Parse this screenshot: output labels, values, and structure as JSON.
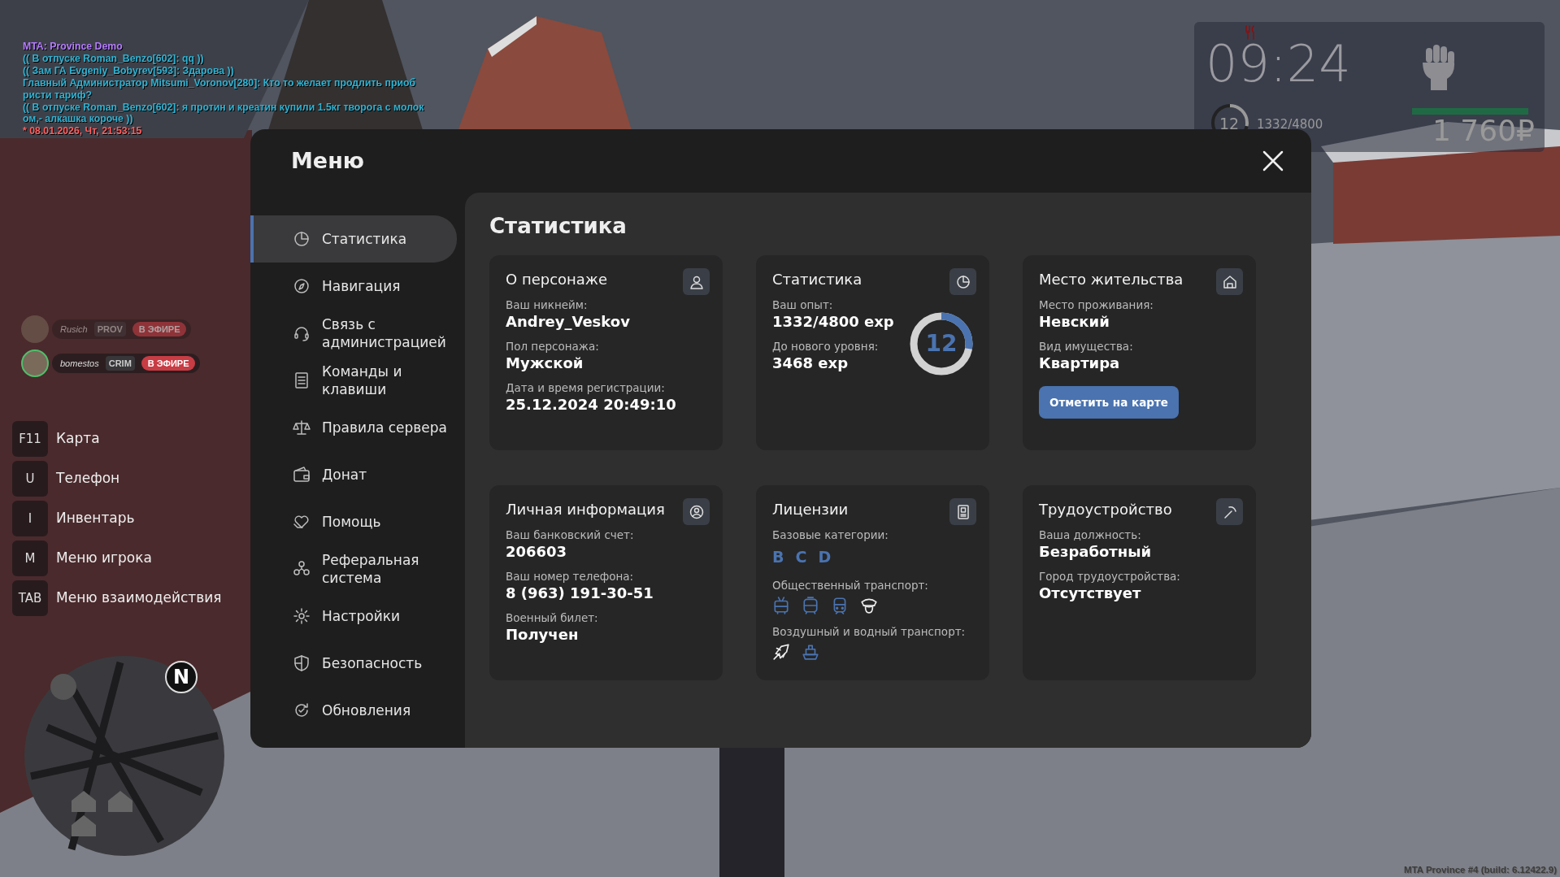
{
  "chat": [
    {
      "text": "MTA: Province Demo",
      "color": "#b57cff"
    },
    {
      "text": "(( В отпуске Roman_Benzo[602]: qq ))",
      "color": "#2fb3d3"
    },
    {
      "text": "(( Зам ГА Evgeniy_Bobyrev[593]: Здарова ))",
      "color": "#2fb3d3"
    },
    {
      "text": "Главный Администратор Mitsumi_Voronov[280]: Кто то желает продлить приоб",
      "color": "#2fb3d3"
    },
    {
      "text": "ристи тариф?",
      "color": "#2fb3d3"
    },
    {
      "text": "(( В отпуске Roman_Benzo[602]: я протин и креатин купили 1.5кг творога с молок",
      "color": "#2fb3d3"
    },
    {
      "text": "ом,- алкашка короче ))",
      "color": "#2fb3d3"
    },
    {
      "text": "* 08.01.2026, Чт, 21:53:15",
      "color": "#ff5f5f"
    }
  ],
  "voice_chat": [
    {
      "name": "Rusich",
      "tag": "PROV",
      "status": "В ЭФИРЕ",
      "active": false
    },
    {
      "name": "bomestos",
      "tag": "CRIM",
      "status": "В ЭФИРЕ",
      "active": true
    }
  ],
  "hotkeys": [
    {
      "key": "F11",
      "label": "Карта"
    },
    {
      "key": "U",
      "label": "Телефон"
    },
    {
      "key": "I",
      "label": "Инвентарь"
    },
    {
      "key": "M",
      "label": "Меню игрока"
    },
    {
      "key": "TAB",
      "label": "Меню взаимодействия"
    }
  ],
  "minimap": {
    "north": "N"
  },
  "hud": {
    "time": "09:24",
    "player_level": "12",
    "exp": "1332/4800",
    "exp_ring": {
      "level": 0.28
    },
    "health": {
      "level": 1
    },
    "money": "1 760₽"
  },
  "menu": {
    "title": "Меню",
    "heading": "Статистика",
    "sidebar": [
      {
        "label": "Статистика",
        "selected": true
      },
      {
        "label": "Навигация",
        "selected": false
      },
      {
        "label": "Связь с администрацией",
        "selected": false
      },
      {
        "label": "Команды и клавиши",
        "selected": false
      },
      {
        "label": "Правила сервера",
        "selected": false
      },
      {
        "label": "Донат",
        "selected": false
      },
      {
        "label": "Помощь",
        "selected": false
      },
      {
        "label": "Реферальная система",
        "selected": false
      },
      {
        "label": "Настройки",
        "selected": false
      },
      {
        "label": "Безопасность",
        "selected": false
      },
      {
        "label": "Обновления",
        "selected": false
      }
    ],
    "cards": [
      {
        "kind": "fields",
        "title": "О персонаже",
        "fields": [
          {
            "label": "Ваш никнейм:",
            "value": "Andrey_Veskov"
          },
          {
            "label": "Пол персонажа:",
            "value": "Мужской"
          },
          {
            "label": "Дата и время регистрации:",
            "value": "25.12.2024 20:49:10"
          }
        ]
      },
      {
        "kind": "fields",
        "title": "Статистика",
        "fields": [
          {
            "label": "Ваш опыт:",
            "value": "1332/4800 exp"
          },
          {
            "label": "До нового уровня:",
            "value": "3468 exp"
          }
        ],
        "ring": {
          "value": "12",
          "level": 0.2775
        }
      },
      {
        "kind": "fields",
        "title": "Место жительства",
        "fields": [
          {
            "label": "Место проживания:",
            "value": "Невский"
          },
          {
            "label": "Вид имущества:",
            "value": "Квартира"
          }
        ],
        "button": "Отметить на карте"
      },
      {
        "kind": "fields",
        "title": "Личная информация",
        "fields": [
          {
            "label": "Ваш банковский счет:",
            "value": "206603"
          },
          {
            "label": "Ваш номер телефона:",
            "value": "8 (963) 191-30-51"
          },
          {
            "label": "Военный билет:",
            "value": "Получен"
          }
        ]
      },
      {
        "kind": "licenses",
        "title": "Лицензии",
        "groups": [
          {
            "kind": "letters",
            "label": "Базовые категории:",
            "items": [
              {
                "text": "B",
                "owned": true
              },
              {
                "text": "C",
                "owned": true
              },
              {
                "text": "D",
                "owned": true
              }
            ]
          },
          {
            "kind": "icons",
            "label": "Общественный транспорт:",
            "items": [
              {
                "owned": true
              },
              {
                "owned": true
              },
              {
                "owned": true
              },
              {
                "owned": false
              }
            ]
          },
          {
            "kind": "icons",
            "label": "Воздушный и водный транспорт:",
            "items": [
              {
                "owned": false
              },
              {
                "owned": true
              }
            ]
          }
        ]
      },
      {
        "kind": "fields",
        "title": "Трудоустройство",
        "fields": [
          {
            "label": "Ваша должность:",
            "value": "Безработный"
          },
          {
            "label": "Город трудоустройства:",
            "value": "Отсутствует"
          }
        ]
      }
    ]
  },
  "build_info": "MTA Province #4 (build: 6.12422.9)"
}
